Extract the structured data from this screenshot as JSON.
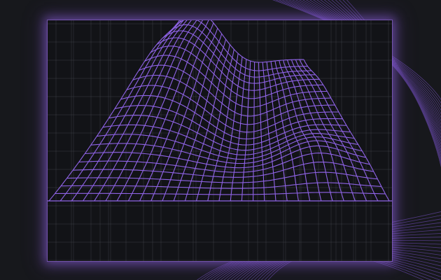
{
  "graphic": {
    "style": "wireframe-surface",
    "colors": {
      "background": "#17181c",
      "panel": "#121317",
      "grid": "#5a5e66",
      "wire": "#8f63e6",
      "glow": "#9b6cf0",
      "decor": "#7f56d4"
    }
  }
}
